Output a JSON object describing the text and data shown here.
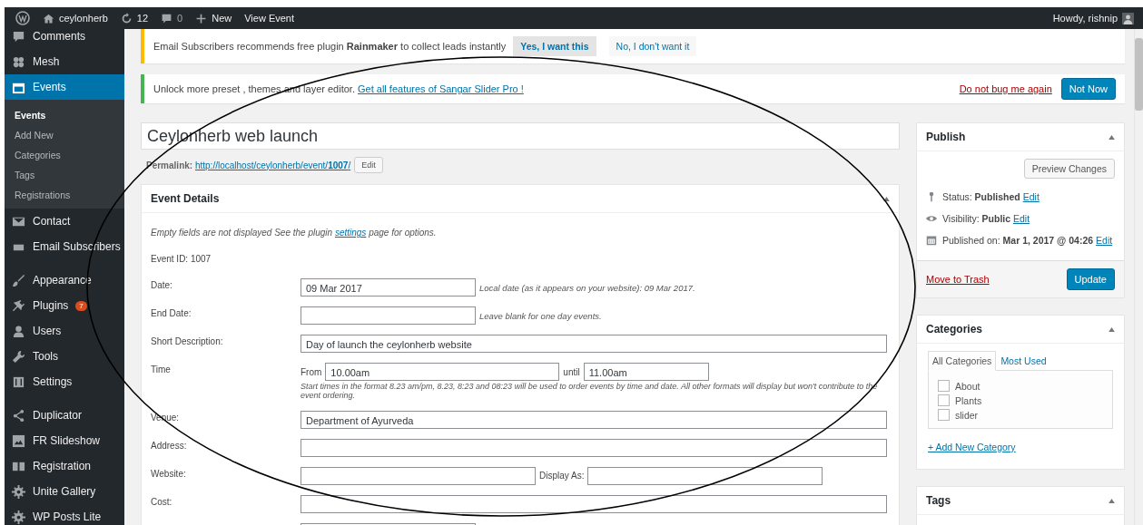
{
  "topbar": {
    "items": [
      {
        "kind": "logo"
      },
      {
        "kind": "home",
        "label": "ceylonherb"
      },
      {
        "kind": "updates",
        "label": "12"
      },
      {
        "kind": "comments",
        "label": "0"
      },
      {
        "kind": "new",
        "label": "New"
      },
      {
        "kind": "text",
        "label": "View Event"
      }
    ],
    "greeting": "Howdy, rishnip"
  },
  "sidebar": {
    "groups": [
      [
        {
          "label": "Comments",
          "selected": false
        },
        {
          "label": "Mesh",
          "selected": false
        },
        {
          "label": "Events",
          "selected": true,
          "children": [
            {
              "label": "Events",
              "selected": true
            },
            {
              "label": "Add New",
              "selected": false
            },
            {
              "label": "Categories",
              "selected": false
            },
            {
              "label": "Tags",
              "selected": false
            },
            {
              "label": "Registrations",
              "selected": false
            }
          ]
        },
        {
          "label": "Contact",
          "selected": false
        },
        {
          "label": "Email Subscribers",
          "selected": false
        }
      ],
      [
        {
          "label": "Appearance",
          "selected": false
        },
        {
          "label": "Plugins",
          "selected": false,
          "badge": "7"
        },
        {
          "label": "Users",
          "selected": false
        },
        {
          "label": "Tools",
          "selected": false
        },
        {
          "label": "Settings",
          "selected": false
        }
      ],
      [
        {
          "label": "Duplicator",
          "selected": false
        },
        {
          "label": "FR Slideshow",
          "selected": false
        },
        {
          "label": "Registration",
          "selected": false
        },
        {
          "label": "Unite Gallery",
          "selected": false
        },
        {
          "label": "WP Posts Lite",
          "selected": false
        }
      ]
    ]
  },
  "notices": [
    {
      "kind": "warning",
      "text": "Email Subscribers recommends free plugin **Rainmaker** to collect leads instantly",
      "buttons": [
        "Yes, I want this",
        "No, I don't want it"
      ]
    },
    {
      "kind": "success",
      "text": "Unlock more preset , themes and layer editor.",
      "link": "Get all features of Sangar Slider Pro !",
      "dismiss": "Do not bug me again",
      "button": "Not Now"
    }
  ],
  "post": {
    "title": "Ceylonherb web launch",
    "permalink_label": "Permalink:",
    "permalink_base": "http://localhost/ceylonherb/event/",
    "permalink_slug": "1007",
    "permalink_end": "/",
    "edit": "Edit"
  },
  "event_details": {
    "title": "Event Details",
    "intro_before": "Empty fields are not displayed See the plugin ",
    "intro_link": "settings",
    "intro_after": " page for options.",
    "event_id": "Event ID: 1007",
    "rows": [
      {
        "kind": "field",
        "label": "Date:",
        "value": "09 Mar 2017",
        "note": "Local date (as it appears on your website): 09 Mar 2017."
      },
      {
        "kind": "field",
        "label": "End Date:",
        "note": "Leave blank for one day events."
      },
      {
        "kind": "field",
        "label": "Short Description:",
        "value": "Day of launch the ceylonherb website"
      },
      {
        "kind": "time",
        "label": "Time",
        "from_label": "From",
        "from": "10.00am",
        "until_label": "until",
        "until": "11.00am",
        "note": "Start times in the format 8.23 am/pm, 8.23, 8:23 and 08:23 will be used to order events by time and date. All other formats will display but won't contribute to the event ordering."
      },
      {
        "kind": "field",
        "label": "Venue:",
        "value": "Department of Ayurveda"
      },
      {
        "kind": "field",
        "label": "Address:"
      },
      {
        "kind": "website",
        "label": "Website:",
        "display_label": "Display As:"
      },
      {
        "kind": "field",
        "label": "Cost:"
      }
    ]
  },
  "publish": {
    "title": "Publish",
    "preview": "Preview Changes",
    "rows": [
      {
        "label": "Status:",
        "value": "Published",
        "link": "Edit"
      },
      {
        "label": "Visibility:",
        "value": "Public",
        "link": "Edit"
      },
      {
        "label": "Published on:",
        "value": "Mar 1, 2017 @ 04:26",
        "link": "Edit"
      }
    ],
    "trash": "Move to Trash",
    "update": "Update"
  },
  "categories": {
    "title": "Categories",
    "tabs": [
      {
        "label": "All Categories",
        "selected": true
      },
      {
        "label": "Most Used",
        "selected": false
      }
    ],
    "items": [
      {
        "label": "About",
        "checked": false
      },
      {
        "label": "Plants",
        "checked": false
      },
      {
        "label": "slider",
        "checked": false
      }
    ],
    "add": "+ Add New Category"
  },
  "tags": {
    "title": "Tags"
  }
}
